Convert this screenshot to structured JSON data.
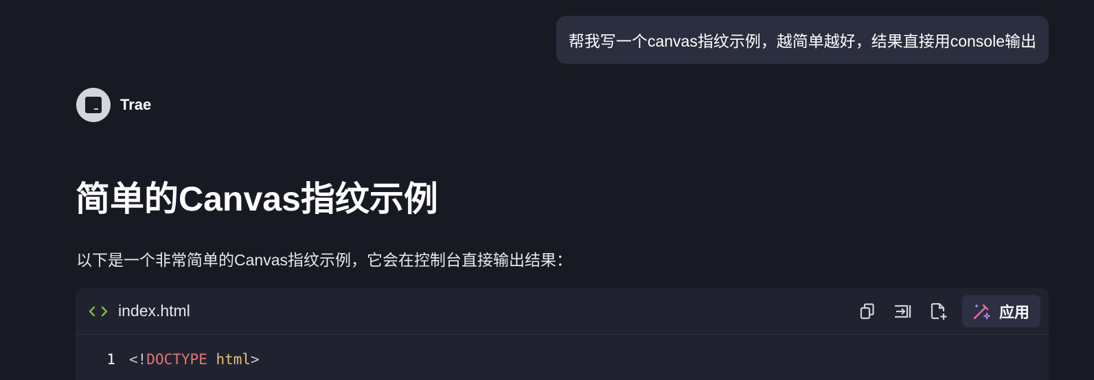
{
  "user_message": "帮我写一个canvas指纹示例，越简单越好，结果直接用console输出",
  "assistant": {
    "name": "Trae"
  },
  "response": {
    "heading": "简单的Canvas指纹示例",
    "intro": "以下是一个非常简单的Canvas指纹示例，它会在控制台直接输出结果："
  },
  "code_block": {
    "filename": "index.html",
    "apply_label": "应用",
    "lines": [
      {
        "number": "1",
        "open": "<!",
        "keyword": "DOCTYPE",
        "attr": "html",
        "close": ">"
      }
    ]
  },
  "colors": {
    "background": "#181a23",
    "bubble": "#2a2e3e",
    "code_bg": "#20232f",
    "keyword": "#e57474",
    "attr": "#e5c07b",
    "code_icon": "#7fbf3f"
  }
}
